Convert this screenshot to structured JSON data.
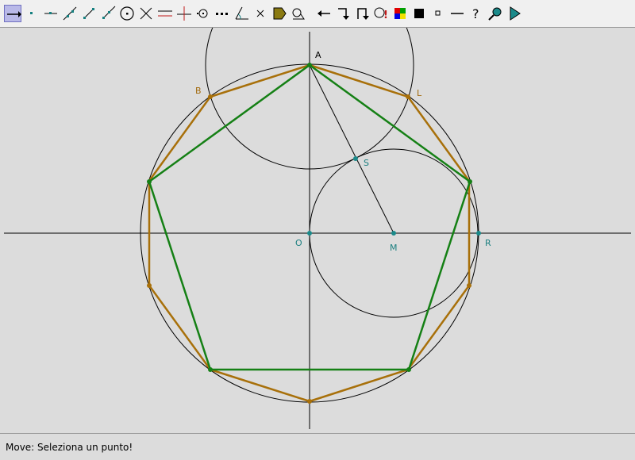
{
  "toolbar": {
    "tools": [
      {
        "name": "move-tool",
        "icon": "move-arrow-icon",
        "active": true
      },
      {
        "name": "point-tool",
        "icon": "point-icon"
      },
      {
        "name": "point-on-object-tool",
        "icon": "point-on-line-icon"
      },
      {
        "name": "line-tool",
        "icon": "line-icon"
      },
      {
        "name": "segment-tool",
        "icon": "segment-icon"
      },
      {
        "name": "ray-tool",
        "icon": "ray-icon"
      },
      {
        "name": "circle-tool",
        "icon": "circle-center-icon"
      },
      {
        "name": "intersection-tool",
        "icon": "intersection-icon"
      },
      {
        "name": "parallel-tool",
        "icon": "parallel-icon"
      },
      {
        "name": "perpendicular-tool",
        "icon": "perpendicular-icon"
      },
      {
        "name": "midpoint-tool",
        "icon": "midpoint-icon"
      },
      {
        "name": "distance-tool",
        "icon": "dotted-segment-icon"
      },
      {
        "name": "angle-tool",
        "icon": "angle-icon"
      },
      {
        "name": "delete-tool",
        "icon": "delete-x-icon"
      },
      {
        "name": "fill-tool",
        "icon": "tag-fill-icon"
      },
      {
        "name": "locus-tool",
        "icon": "locus-icon"
      },
      {
        "name": "undo-tool",
        "icon": "left-arrow-icon"
      },
      {
        "name": "redo-tool",
        "icon": "redo-arrow-icon"
      },
      {
        "name": "hide-tool",
        "icon": "hook-arrow-icon"
      },
      {
        "name": "rename-tool",
        "icon": "rename-icon"
      },
      {
        "name": "color-tool",
        "icon": "color-palette-icon"
      },
      {
        "name": "thickness-tool",
        "icon": "black-square-icon"
      },
      {
        "name": "point-style-tool",
        "icon": "small-square-icon"
      },
      {
        "name": "line-style-tool",
        "icon": "dash-icon"
      },
      {
        "name": "help-tool",
        "icon": "question-icon"
      },
      {
        "name": "zoom-tool",
        "icon": "magnifier-icon"
      },
      {
        "name": "play-tool",
        "icon": "play-icon"
      }
    ]
  },
  "colors": {
    "background": "#dcdcdc",
    "axis": "#000000",
    "circle": "#000000",
    "pentagon": "#158015",
    "decagon": "#a8700a",
    "point_teal": "#1b8a8a",
    "label_teal": "#1b7f80",
    "label_orange": "#a26a0e",
    "label_dark": "#000000"
  },
  "geometry": {
    "points": [
      {
        "name": "A",
        "color": "point_pent"
      },
      {
        "name": "B",
        "color": "decagon"
      },
      {
        "name": "L",
        "color": "decagon"
      },
      {
        "name": "S",
        "color": "teal"
      },
      {
        "name": "O",
        "color": "teal"
      },
      {
        "name": "M",
        "color": "teal"
      },
      {
        "name": "R",
        "color": "teal"
      }
    ]
  },
  "labels": {
    "A": "A",
    "B": "B",
    "L": "L",
    "S": "S",
    "O": "O",
    "M": "M",
    "R": "R"
  },
  "status": {
    "text": "Move: Seleziona un punto!"
  }
}
